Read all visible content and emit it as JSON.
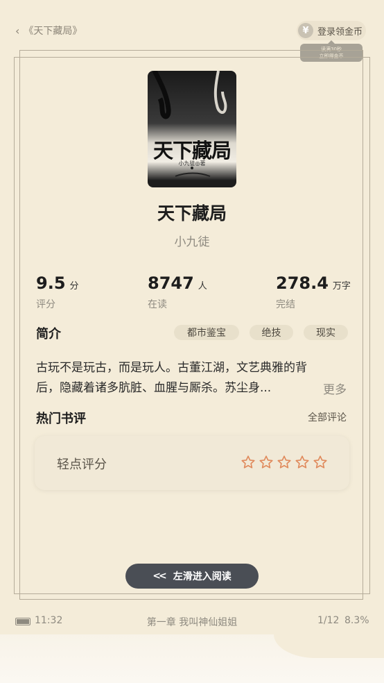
{
  "topbar": {
    "back_label": "《天下藏局》",
    "coin_label": "登录领金币",
    "coin_symbol": "¥",
    "coin_tip_line1": "读满30秒",
    "coin_tip_line2": "立即得金币"
  },
  "book": {
    "cover_title": "天下藏局",
    "cover_author": "小九徒◎著",
    "title": "天下藏局",
    "author": "小九徒"
  },
  "stats": [
    {
      "value": "9.5",
      "unit": "分",
      "label": "评分"
    },
    {
      "value": "8747",
      "unit": "人",
      "label": "在读"
    },
    {
      "value": "278.4",
      "unit": "万字",
      "label": "完结"
    }
  ],
  "intro": {
    "heading": "简介",
    "tags": [
      "都市鉴宝",
      "绝技",
      "现实"
    ],
    "text_line1": "古玩不是玩古，而是玩人。古董江湖，文艺典雅的背",
    "text_line2": "后，隐藏着诸多肮脏、血腥与厮杀。苏尘身...",
    "more_label": "更多"
  },
  "reviews": {
    "heading": "热门书评",
    "all_label": "全部评论",
    "rate_label": "轻点评分",
    "rating_filled": 0,
    "rating_max": 5
  },
  "read_button": {
    "icon": "double-chevron-left-icon",
    "label": "左滑进入阅读"
  },
  "statusbar": {
    "time": "11:32",
    "chapter": "第一章 我叫神仙姐姐",
    "page": "1/12",
    "progress": "8.3%"
  },
  "colors": {
    "background": "#f4ecd9",
    "star": "#e08a5c",
    "button": "#4a4e55"
  }
}
